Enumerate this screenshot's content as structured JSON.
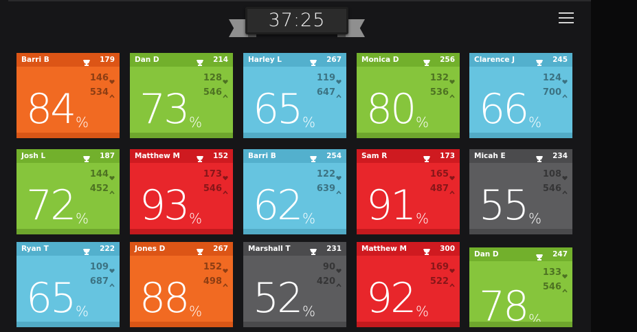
{
  "timer": "37:25",
  "colors": {
    "orange": "#f16a22",
    "green": "#86c53c",
    "blue": "#66c4e0",
    "red": "#e8262b",
    "gray": "#5c5c5e"
  },
  "icons": {
    "menu": "hamburger-menu-icon",
    "score": "trophy-icon",
    "stat1": "heart-icon",
    "stat2": "chevron-up-icon"
  },
  "cards": [
    {
      "name": "Barri B",
      "score": "179",
      "stat1": "146",
      "stat2": "534",
      "percent": "84",
      "percent_sign": "%",
      "color": "orange"
    },
    {
      "name": "Dan D",
      "score": "214",
      "stat1": "128",
      "stat2": "546",
      "percent": "73",
      "percent_sign": "%",
      "color": "green"
    },
    {
      "name": "Harley L",
      "score": "267",
      "stat1": "119",
      "stat2": "647",
      "percent": "65",
      "percent_sign": "%",
      "color": "blue"
    },
    {
      "name": "Monica D",
      "score": "256",
      "stat1": "132",
      "stat2": "536",
      "percent": "80",
      "percent_sign": "%",
      "color": "green"
    },
    {
      "name": "Clarence J",
      "score": "245",
      "stat1": "124",
      "stat2": "700",
      "percent": "66",
      "percent_sign": "%",
      "color": "blue"
    },
    {
      "name": "Josh L",
      "score": "187",
      "stat1": "144",
      "stat2": "452",
      "percent": "72",
      "percent_sign": "%",
      "color": "green"
    },
    {
      "name": "Matthew M",
      "score": "152",
      "stat1": "173",
      "stat2": "546",
      "percent": "93",
      "percent_sign": "%",
      "color": "red"
    },
    {
      "name": "Barri B",
      "score": "254",
      "stat1": "122",
      "stat2": "639",
      "percent": "62",
      "percent_sign": "%",
      "color": "blue"
    },
    {
      "name": "Sam R",
      "score": "173",
      "stat1": "165",
      "stat2": "487",
      "percent": "91",
      "percent_sign": "%",
      "color": "red"
    },
    {
      "name": "Micah E",
      "score": "234",
      "stat1": "108",
      "stat2": "546",
      "percent": "55",
      "percent_sign": "%",
      "color": "gray"
    },
    {
      "name": "Ryan T",
      "score": "222",
      "stat1": "109",
      "stat2": "687",
      "percent": "65",
      "percent_sign": "%",
      "color": "blue"
    },
    {
      "name": "Jones D",
      "score": "267",
      "stat1": "152",
      "stat2": "498",
      "percent": "88",
      "percent_sign": "%",
      "color": "orange"
    },
    {
      "name": "Marshall T",
      "score": "231",
      "stat1": "90",
      "stat2": "420",
      "percent": "52",
      "percent_sign": "%",
      "color": "gray"
    },
    {
      "name": "Matthew M",
      "score": "300",
      "stat1": "169",
      "stat2": "522",
      "percent": "92",
      "percent_sign": "%",
      "color": "red"
    },
    {
      "name": "Dan D",
      "score": "247",
      "stat1": "133",
      "stat2": "546",
      "percent": "78",
      "percent_sign": "%",
      "color": "green"
    }
  ]
}
